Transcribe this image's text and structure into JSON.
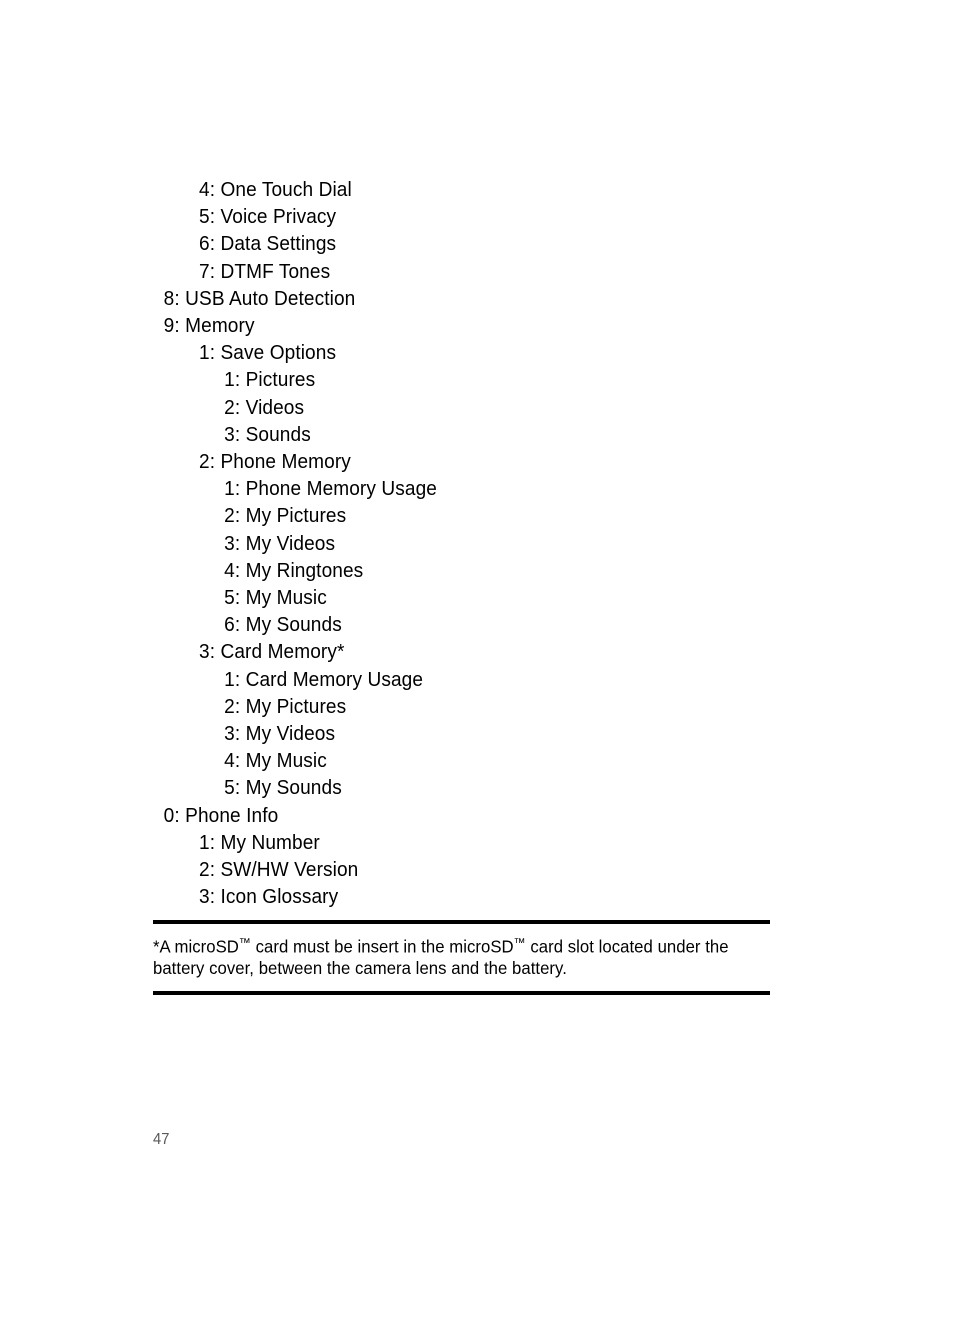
{
  "document": {
    "page_number": "47",
    "menu_items": [
      {
        "indent": 2,
        "text": "4: One Touch Dial"
      },
      {
        "indent": 2,
        "text": "5: Voice Privacy"
      },
      {
        "indent": 2,
        "text": "6: Data Settings"
      },
      {
        "indent": 2,
        "text": "7: DTMF Tones"
      },
      {
        "indent": 1,
        "text": "8: USB Auto Detection"
      },
      {
        "indent": 1,
        "text": "9: Memory"
      },
      {
        "indent": 2,
        "text": "1: Save Options"
      },
      {
        "indent": 3,
        "text": "1: Pictures"
      },
      {
        "indent": 3,
        "text": "2: Videos"
      },
      {
        "indent": 3,
        "text": "3: Sounds"
      },
      {
        "indent": 2,
        "text": "2: Phone Memory"
      },
      {
        "indent": 3,
        "text": "1: Phone Memory Usage"
      },
      {
        "indent": 3,
        "text": "2: My Pictures"
      },
      {
        "indent": 3,
        "text": "3: My Videos"
      },
      {
        "indent": 3,
        "text": "4: My Ringtones"
      },
      {
        "indent": 3,
        "text": "5: My Music"
      },
      {
        "indent": 3,
        "text": "6: My Sounds"
      },
      {
        "indent": 2,
        "text": "3: Card Memory*"
      },
      {
        "indent": 3,
        "text": "1: Card Memory Usage"
      },
      {
        "indent": 3,
        "text": "2: My Pictures"
      },
      {
        "indent": 3,
        "text": "3: My Videos"
      },
      {
        "indent": 3,
        "text": "4: My Music"
      },
      {
        "indent": 3,
        "text": "5: My Sounds"
      },
      {
        "indent": 1,
        "text": "0: Phone Info"
      },
      {
        "indent": 2,
        "text": "1: My Number"
      },
      {
        "indent": 2,
        "text": "2: SW/HW Version"
      },
      {
        "indent": 2,
        "text": "3: Icon Glossary"
      }
    ],
    "footnote": {
      "prefix": "*A microSD",
      "trademark": "™",
      "middle": " card must be insert in the microSD",
      "trademark2": "™",
      "suffix": "  card slot located under the battery cover, between the camera lens and the battery."
    }
  }
}
